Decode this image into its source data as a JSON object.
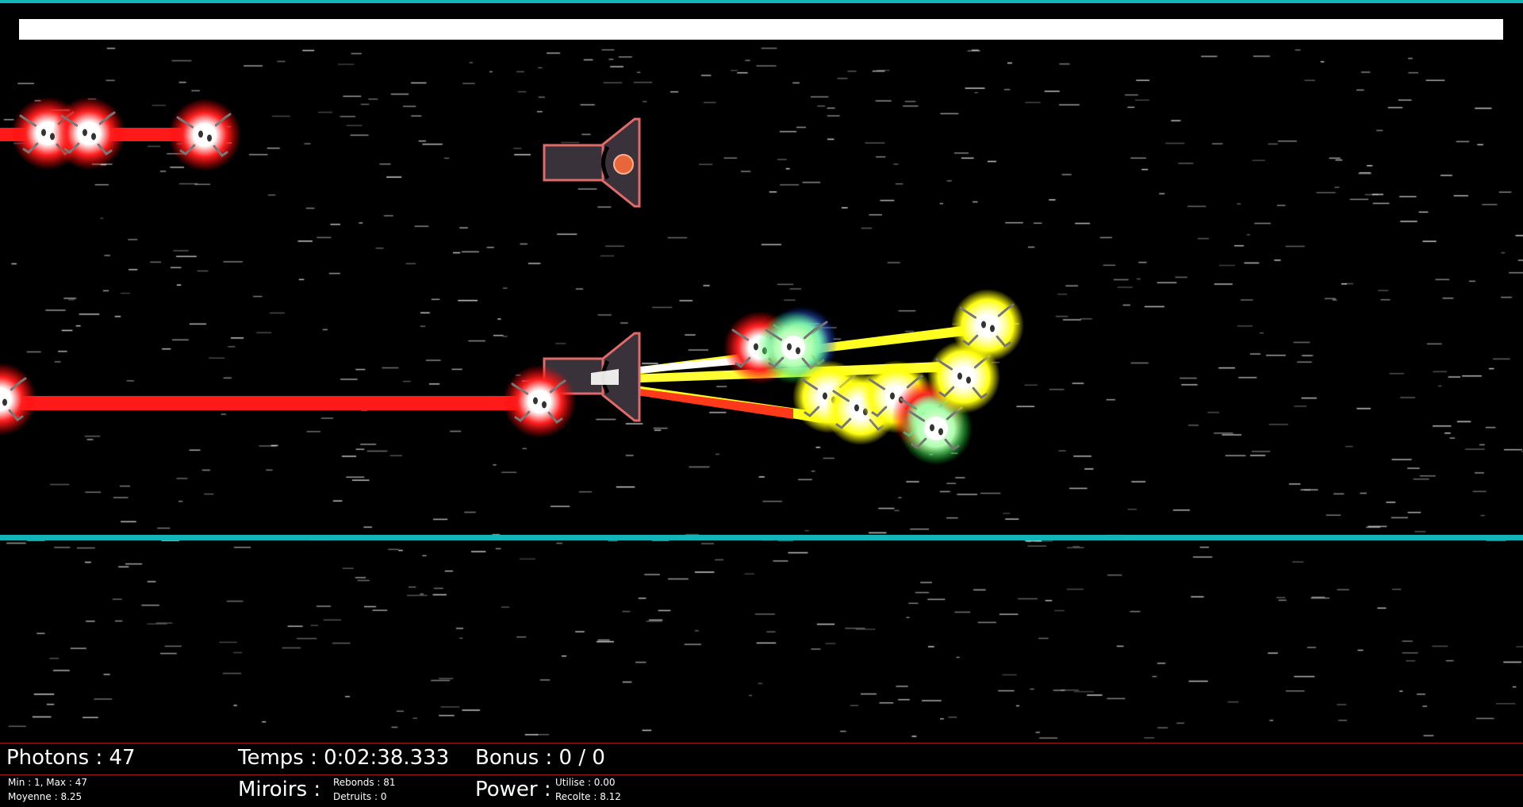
{
  "colors": {
    "accent": "#13b5b8",
    "laser_red": "#ff1a1a",
    "laser_yellow": "#ffff22",
    "emitter_body": "#3a323a",
    "emitter_outline": "#e06a6a",
    "hud_line": "#a31616"
  },
  "progress": {
    "fraction": 1.0
  },
  "hud": {
    "photons": "Photons : 47",
    "photons_minmax": "Min : 1, Max : 47",
    "photons_avg": "Moyenne : 8.25",
    "temps": "Temps : 0:02:38.333",
    "miroirs": "Miroirs :",
    "rebonds": "Rebonds : 81",
    "detruits": "Detruits : 0",
    "bonus": "Bonus : 0 / 0",
    "power": "Power :",
    "utilise": "Utilise : 0.00",
    "recolte": "Recolte : 8.12"
  },
  "icons": {
    "emitter": "laser-emitter-icon",
    "photon": "photon-creature-icon"
  }
}
